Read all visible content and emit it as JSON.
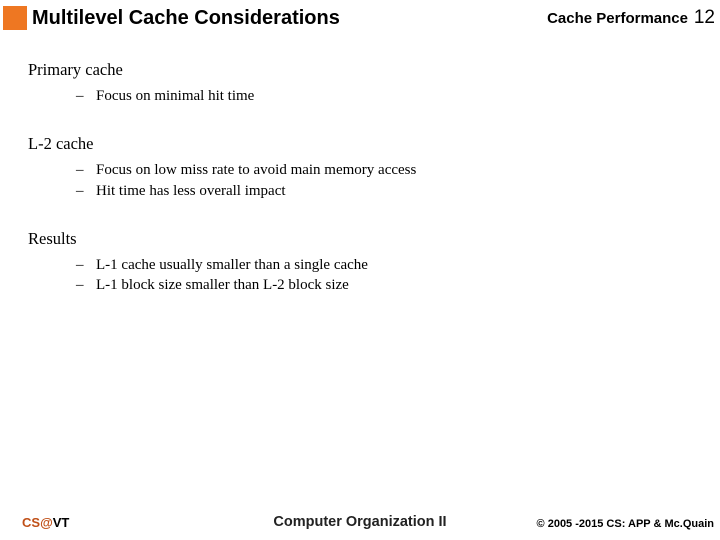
{
  "header": {
    "title": "Multilevel Cache Considerations",
    "topic": "Cache Performance",
    "page": "12"
  },
  "sections": [
    {
      "heading": "Primary cache",
      "bullets": [
        "Focus on minimal hit time"
      ]
    },
    {
      "heading": "L-2 cache",
      "bullets": [
        "Focus on low miss rate to avoid main memory access",
        "Hit time has less overall impact"
      ]
    },
    {
      "heading": "Results",
      "bullets": [
        "L-1 cache usually smaller than a single cache",
        "L-1 block size smaller than L-2 block size"
      ]
    }
  ],
  "footer": {
    "left_cs": "CS",
    "left_at": "@",
    "left_vt": "VT",
    "center": "Computer Organization II",
    "right": "© 2005 -2015 CS: APP & Mc.Quain"
  }
}
